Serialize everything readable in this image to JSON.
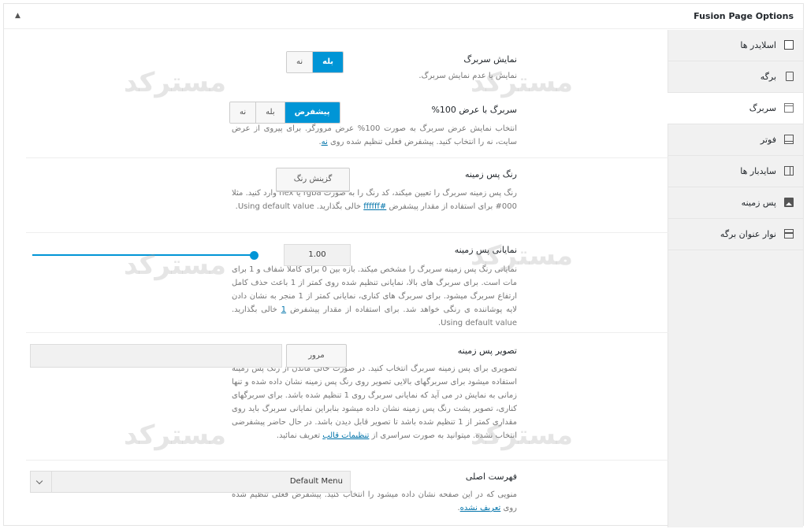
{
  "metabox": {
    "title": "Fusion Page Options"
  },
  "tabs": [
    {
      "label": "اسلایدر ها",
      "icon": "slides-icon"
    },
    {
      "label": "برگه",
      "icon": "page-icon"
    },
    {
      "label": "سربرگ",
      "icon": "header-icon"
    },
    {
      "label": "فوتر",
      "icon": "footer-icon"
    },
    {
      "label": "سایدبار ها",
      "icon": "sidebar-icon"
    },
    {
      "label": "پس زمینه",
      "icon": "image-icon"
    },
    {
      "label": "نوار عنوان برگه",
      "icon": "titlebar-icon"
    }
  ],
  "options": {
    "display_header": {
      "title": "نمایش سربرگ",
      "desc": "نمایش یا عدم نمایش سربرگ.",
      "buttons": [
        "بله",
        "نه"
      ],
      "selected": "بله"
    },
    "header_100": {
      "title": "سربرگ با عرض 100%",
      "desc": "انتخاب نمایش عرض سربرگ به صورت 100% عرض مرورگر. برای پیروی از عرض سایت، نه را انتخاب کنید. پیشفرض فعلی تنظیم شده روی",
      "desc_link": "نه",
      "buttons": [
        "پیشفرض",
        "بله",
        "نه"
      ],
      "selected": "پیشفرض"
    },
    "header_bg_color": {
      "title": "رنگ پس زمینه",
      "desc": "رنگ پس زمینه سربرگ را تعیین میکند، کد رنگ را به صورت rgba یا hex وارد کنید. مثلا 000# برای استفاده از مقدار پیشفرض",
      "desc_link": "#ffffff",
      "desc_after": "خالی بگذارید. Using default value.",
      "button": "گزینش رنگ"
    },
    "header_bg_opacity": {
      "title": "نمایانی پس زمینه",
      "desc": "نمایانی رنگ پس زمینه سربرگ را مشخص میکند. بازه بین 0 برای کاملا شفاف و 1 برای مات است. برای سربرگ های بالا، نمایانی تنظیم شده روی کمتر از 1 باعث حذف کامل ارتفاع سربرگ میشود. برای سربرگ های کناری، نمایانی کمتر از 1 منجر به نشان دادن لایه پوشاننده ی رنگی خواهد شد. برای استفاده از مقدار پیشفرض",
      "desc_link": "1",
      "desc_after": "خالی بگذارید. Using default value.",
      "value": "1.00",
      "level": 1.0
    },
    "header_bg_image": {
      "title": "تصویر پس زمینه",
      "desc": "تصویری برای پس زمینه سربرگ انتخاب کنید. در صورت خالی ماندن از رنگ پس زمینه استفاده میشود برای سربرگهای بالایی تصویر روی رنگ پس زمینه نشان داده شده و تنها زمانی به نمایش در می آید که نمایانی سربرگ روی 1 تنظیم شده باشد. برای سربرگهای کناری، تصویر پشت رنگ پس زمینه نشان داده میشود بنابراین نمایانی سربرگ باید روی مقداری کمتر از 1 تنظیم شده باشد تا تصویر قابل دیدن باشد. در حال حاضر پیشفرضی انتخاب نشده. میتوانید به صورت سراسری از",
      "desc_link": "تنظیمات قالب",
      "desc_after": "تعریف نمائید.",
      "button": "مرور"
    },
    "main_menu": {
      "title": "فهرست اصلی",
      "desc": "منویی که در این صفحه نشان داده میشود را انتخاب کنید. پیشفرض فعلی تنظیم شده روی",
      "desc_link": "تعریف نشده",
      "select_value": "Default Menu"
    }
  },
  "watermark": "مسترکد",
  "colors": {
    "accent": "#0095d6",
    "link": "#0073aa"
  }
}
